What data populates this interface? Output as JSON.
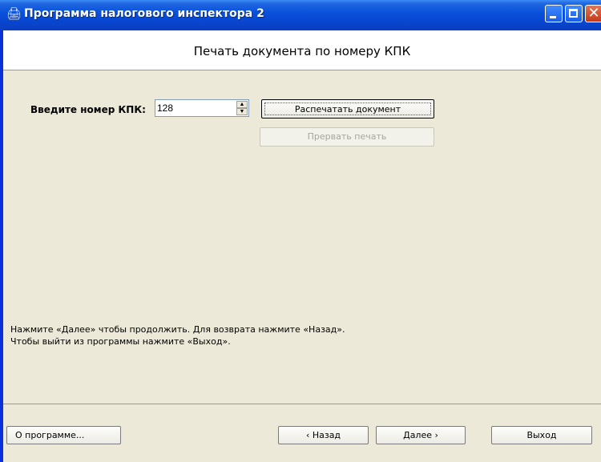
{
  "window": {
    "title": "Программа налогового инспектора 2",
    "app_icon": "printer-icon",
    "controls": {
      "minimize": "minimize-icon",
      "maximize": "maximize-icon",
      "close": "close-icon",
      "close_glyph": "✕"
    }
  },
  "header": {
    "title": "Печать документа по номеру КПК"
  },
  "form": {
    "kpk_label": "Введите номер КПК:",
    "kpk_value": "128",
    "spin_up": "▲",
    "spin_down": "▼",
    "print_button": "Распечатать документ",
    "abort_button": "Прервать печать"
  },
  "info": {
    "line1": "Нажмите «Далее» чтобы продолжить. Для возврата нажмите «Назад».",
    "line2": "Чтобы выйти из программы нажмите «Выход»."
  },
  "footer": {
    "about_button": "О программе...",
    "back_button": "‹ Назад",
    "next_button": "Далее ›",
    "exit_button": "Выход"
  },
  "colors": {
    "titlebar": "#0a52db",
    "client_bg": "#ece9d8",
    "header_bg": "#ffffff"
  }
}
